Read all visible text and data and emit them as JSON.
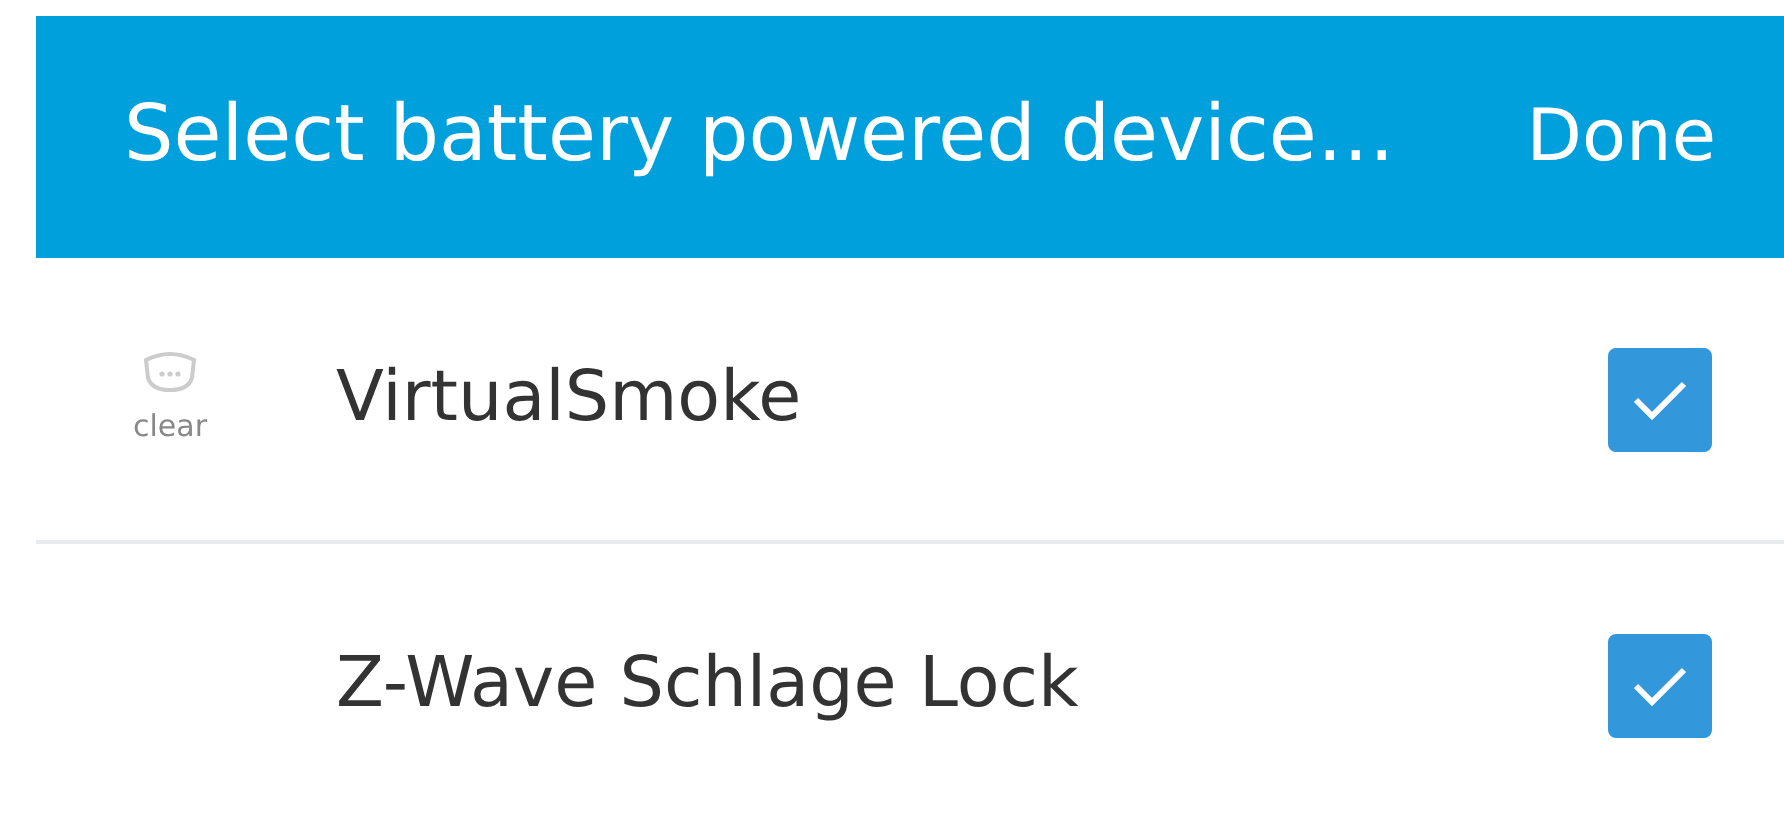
{
  "header": {
    "title": "Select battery powered device…",
    "action": "Done"
  },
  "devices": [
    {
      "name": "VirtualSmoke",
      "status": "clear",
      "checked": true
    },
    {
      "name": "Z-Wave Schlage Lock",
      "checked": true
    }
  ]
}
